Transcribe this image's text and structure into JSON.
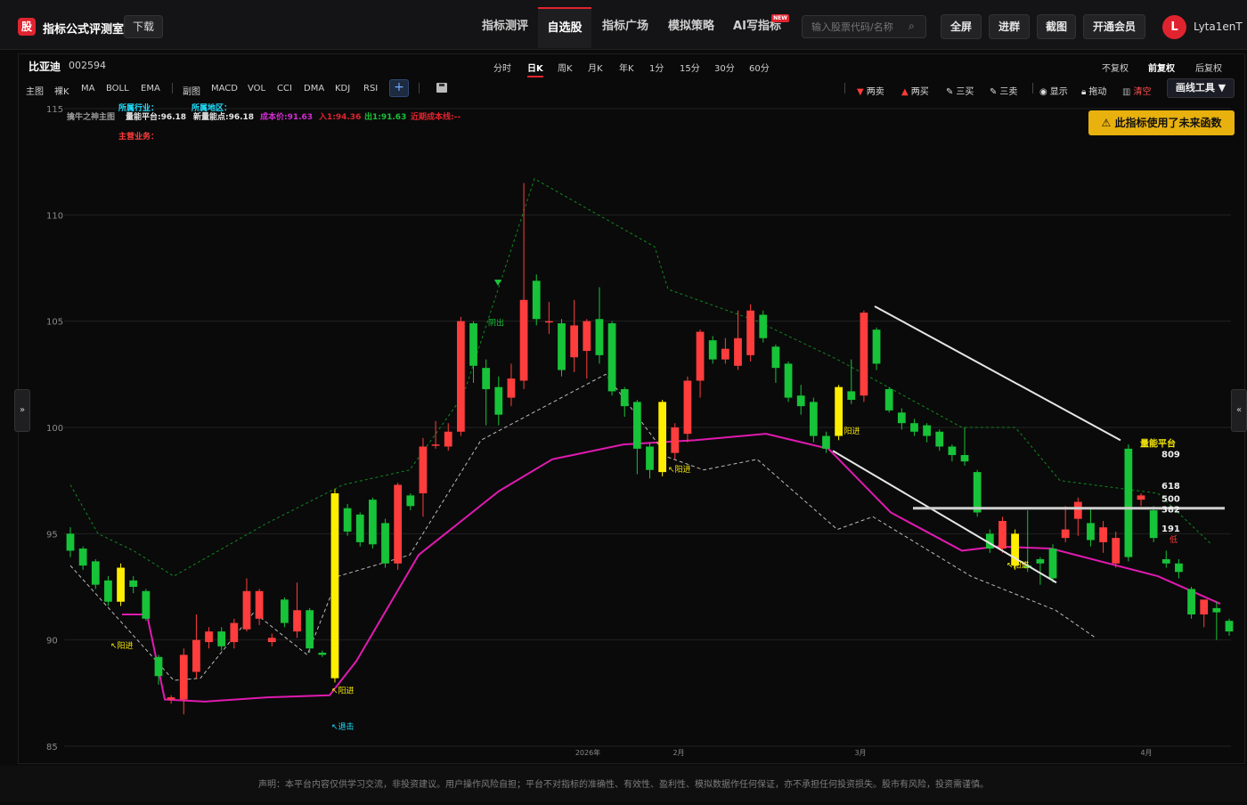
{
  "app": {
    "logo_char": "股",
    "brand": "指标公式评测室",
    "download": "下载"
  },
  "nav": [
    {
      "label": "指标测评",
      "active": false
    },
    {
      "label": "自选股",
      "active": true
    },
    {
      "label": "指标广场",
      "active": false
    },
    {
      "label": "模拟策略",
      "active": false
    },
    {
      "label": "AI写指标",
      "active": false,
      "badge": "NEW"
    }
  ],
  "search": {
    "placeholder": "输入股票代码/名称",
    "icon": "search-icon"
  },
  "top_buttons": [
    "全屏",
    "进群",
    "截图",
    "开通会员"
  ],
  "user": {
    "initial": "L",
    "name": "Lyta1enT"
  },
  "stock": {
    "name": "比亚迪",
    "code": "002594"
  },
  "periods": [
    {
      "label": "分时",
      "active": false
    },
    {
      "label": "日K",
      "active": true
    },
    {
      "label": "周K",
      "active": false
    },
    {
      "label": "月K",
      "active": false
    },
    {
      "label": "年K",
      "active": false
    },
    {
      "label": "1分",
      "active": false
    },
    {
      "label": "15分",
      "active": false
    },
    {
      "label": "30分",
      "active": false
    },
    {
      "label": "60分",
      "active": false
    }
  ],
  "adjust": [
    {
      "label": "不复权",
      "active": false
    },
    {
      "label": "前复权",
      "active": true
    },
    {
      "label": "后复权",
      "active": false
    }
  ],
  "main_indicators": [
    "主图",
    "裸K",
    "MA",
    "BOLL",
    "EMA"
  ],
  "sub_indicators": [
    "副图",
    "MACD",
    "VOL",
    "CCI",
    "DMA",
    "KDJ",
    "RSI"
  ],
  "tools": [
    {
      "label": "两卖",
      "icon": "down-triangle-icon",
      "color": "#ff3b3b"
    },
    {
      "label": "两买",
      "icon": "up-triangle-icon",
      "color": "#ff3b3b"
    },
    {
      "label": "三买",
      "icon": "pen-icon",
      "color": "#dddddd"
    },
    {
      "label": "三卖",
      "icon": "pen-icon",
      "color": "#dddddd"
    },
    {
      "label": "显示",
      "icon": "eye-icon",
      "color": "#dddddd"
    },
    {
      "label": "拖动",
      "icon": "lock-icon",
      "color": "#dddddd"
    },
    {
      "label": "清空",
      "icon": "trash-icon",
      "color": "#ff4d4d"
    }
  ],
  "draw_tools": "画线工具 ▼",
  "warning": "此指标使用了未来函数",
  "chart_info": {
    "industry_label": "所属行业：",
    "region_label": "所属地区：",
    "main_business": "主营业务：",
    "indicator_name": "擒牛之神主图",
    "vol_platform": "量能平台:96.18",
    "new_vol_point": "新量能点:96.18",
    "cost": "成本价:91.63",
    "entry": "入1:94.36",
    "exit": "出1:91.63",
    "recent_cost": "近期成本线:--"
  },
  "signals": {
    "buy": "阳进",
    "sell": "阴出",
    "exit": "退击",
    "vol_flat": "量能平台",
    "low": "低"
  },
  "fib_levels": [
    "809",
    "618",
    "500",
    "382",
    "191"
  ],
  "chart_data": {
    "type": "candlestick",
    "ylim": [
      85,
      115
    ],
    "yticks": [
      85,
      90,
      95,
      100,
      105,
      110,
      115
    ],
    "xtick_labels": [
      "2026年",
      "2月",
      "3月",
      "4月"
    ],
    "candles": [
      [
        95.0,
        94.2,
        95.3,
        93.9
      ],
      [
        94.3,
        93.5,
        94.4,
        93.3
      ],
      [
        93.7,
        92.6,
        93.8,
        92.4
      ],
      [
        92.8,
        91.8,
        93.0,
        91.6
      ],
      [
        91.8,
        93.4,
        93.6,
        91.6
      ],
      [
        92.8,
        92.5,
        93.0,
        92.2
      ],
      [
        92.3,
        91.0,
        92.4,
        90.9
      ],
      [
        89.2,
        88.3,
        89.3,
        87.9
      ],
      [
        87.2,
        87.3,
        87.4,
        87.0
      ],
      [
        87.2,
        89.3,
        89.6,
        86.5
      ],
      [
        88.5,
        90.0,
        91.2,
        88.2
      ],
      [
        89.9,
        90.4,
        90.6,
        89.6
      ],
      [
        90.4,
        89.7,
        90.6,
        89.5
      ],
      [
        89.9,
        90.8,
        91.0,
        89.6
      ],
      [
        90.5,
        92.3,
        92.9,
        90.4
      ],
      [
        91.0,
        92.3,
        92.4,
        90.7
      ],
      [
        89.9,
        90.1,
        90.3,
        89.7
      ],
      [
        91.9,
        90.8,
        92.0,
        90.6
      ],
      [
        90.4,
        91.4,
        92.7,
        90.1
      ],
      [
        91.4,
        89.6,
        91.5,
        89.4
      ],
      [
        89.4,
        89.3,
        89.5,
        89.2
      ],
      [
        88.2,
        96.9,
        97.1,
        88.0
      ],
      [
        96.2,
        95.1,
        96.4,
        94.9
      ],
      [
        95.9,
        94.6,
        96.0,
        94.4
      ],
      [
        96.6,
        94.5,
        96.7,
        94.3
      ],
      [
        95.5,
        93.6,
        95.7,
        93.4
      ],
      [
        93.6,
        97.3,
        97.4,
        93.3
      ],
      [
        96.8,
        96.3,
        96.9,
        96.1
      ],
      [
        96.9,
        99.1,
        99.5,
        95.8
      ],
      [
        99.2,
        99.2,
        100.3,
        99.0
      ],
      [
        99.1,
        99.8,
        100.2,
        98.9
      ],
      [
        99.8,
        105.0,
        105.2,
        99.6
      ],
      [
        104.9,
        102.9,
        105.0,
        102.1
      ],
      [
        102.8,
        101.8,
        103.2,
        100.1
      ],
      [
        101.9,
        100.6,
        102.4,
        100.1
      ],
      [
        101.4,
        102.3,
        103.0,
        101.0
      ],
      [
        102.2,
        106.0,
        111.5,
        101.8
      ],
      [
        106.9,
        105.1,
        107.2,
        104.8
      ],
      [
        105.0,
        105.0,
        105.9,
        104.4
      ],
      [
        104.9,
        102.7,
        105.1,
        102.4
      ],
      [
        103.3,
        104.8,
        106.0,
        102.6
      ],
      [
        103.6,
        105.0,
        105.1,
        102.3
      ],
      [
        105.1,
        103.4,
        106.6,
        103.0
      ],
      [
        104.9,
        101.7,
        105.0,
        101.5
      ],
      [
        101.8,
        101.0,
        101.9,
        100.5
      ],
      [
        101.2,
        99.0,
        101.3,
        97.8
      ],
      [
        99.1,
        98.0,
        99.3,
        97.6
      ],
      [
        97.9,
        101.2,
        101.3,
        97.7
      ],
      [
        98.8,
        100.0,
        100.2,
        98.5
      ],
      [
        99.7,
        102.2,
        102.4,
        99.3
      ],
      [
        102.2,
        104.5,
        104.6,
        101.4
      ],
      [
        104.1,
        103.2,
        104.3,
        103.0
      ],
      [
        103.2,
        103.7,
        104.2,
        103.0
      ],
      [
        102.9,
        104.2,
        105.5,
        102.7
      ],
      [
        103.4,
        105.5,
        105.8,
        103.1
      ],
      [
        105.3,
        104.2,
        105.5,
        104.0
      ],
      [
        103.8,
        102.8,
        103.9,
        102.1
      ],
      [
        103.0,
        101.4,
        103.1,
        101.2
      ],
      [
        101.5,
        101.0,
        102.0,
        100.6
      ],
      [
        101.2,
        99.6,
        101.4,
        99.3
      ],
      [
        99.6,
        99.0,
        99.8,
        98.8
      ],
      [
        101.9,
        99.6,
        102.0,
        99.4
      ],
      [
        101.7,
        101.3,
        103.2,
        101.1
      ],
      [
        101.5,
        105.4,
        105.5,
        101.2
      ],
      [
        104.6,
        103.0,
        104.7,
        102.7
      ],
      [
        101.8,
        100.8,
        101.9,
        100.7
      ],
      [
        100.7,
        100.2,
        100.9,
        99.9
      ],
      [
        100.2,
        99.8,
        100.4,
        99.6
      ],
      [
        100.1,
        99.6,
        100.2,
        99.3
      ],
      [
        99.8,
        99.1,
        99.9,
        98.9
      ],
      [
        99.1,
        98.7,
        99.2,
        98.4
      ],
      [
        98.7,
        98.4,
        100.0,
        98.2
      ],
      [
        97.9,
        96.0,
        98.0,
        95.8
      ],
      [
        95.0,
        94.3,
        95.2,
        94.1
      ],
      [
        94.3,
        95.6,
        95.8,
        94.1
      ],
      [
        95.0,
        93.5,
        95.2,
        93.3
      ],
      [
        93.5,
        93.4,
        96.1,
        93.2
      ],
      [
        93.8,
        93.6,
        93.9,
        92.6
      ],
      [
        94.3,
        92.9,
        94.5,
        92.7
      ],
      [
        94.8,
        95.2,
        96.3,
        94.6
      ],
      [
        95.7,
        96.5,
        96.7,
        94.9
      ],
      [
        95.5,
        94.7,
        96.2,
        94.4
      ],
      [
        94.6,
        95.3,
        95.6,
        94.1
      ],
      [
        93.6,
        94.8,
        95.1,
        93.4
      ],
      [
        99.0,
        93.9,
        99.2,
        93.7
      ],
      [
        96.6,
        96.8,
        96.9,
        96.3
      ],
      [
        96.1,
        94.8,
        96.3,
        94.6
      ],
      [
        93.8,
        93.6,
        94.2,
        93.4
      ],
      [
        93.6,
        93.2,
        93.8,
        92.9
      ],
      [
        92.4,
        91.2,
        92.5,
        91.0
      ],
      [
        91.2,
        91.9,
        91.3,
        90.6
      ],
      [
        91.5,
        91.3,
        91.8,
        90.0
      ],
      [
        90.9,
        90.4,
        91.0,
        90.2
      ]
    ],
    "pink_line": [
      91.2,
      91.2,
      87.2,
      87.1,
      87.3,
      87.4,
      89.0,
      94.0,
      97.0,
      98.5,
      99.2,
      99.4,
      99.7,
      99.0,
      96.0,
      94.2,
      94.4,
      94.3,
      93.0,
      91.7
    ],
    "grey_dashed": [
      93.5,
      88.1,
      88.2,
      91.3,
      89.3,
      93.0,
      94.0,
      99.4,
      102.5,
      98.6,
      98.0,
      98.5,
      95.2,
      95.8,
      93.0,
      91.4,
      90.1
    ]
  },
  "side": {
    "left": "»",
    "right": "«"
  },
  "footer": "声明：本平台内容仅供学习交流，非投资建议。用户操作风险自担；平台不对指标的准确性、有效性、盈利性、模拟数据作任何保证，亦不承担任何投资损失。股市有风险，投资需谨慎。",
  "colors": {
    "up": "#ff3d3d",
    "down": "#17c338",
    "highlight": "#ffee00",
    "accent": "#e0242f",
    "pink": "#e01ab0"
  }
}
